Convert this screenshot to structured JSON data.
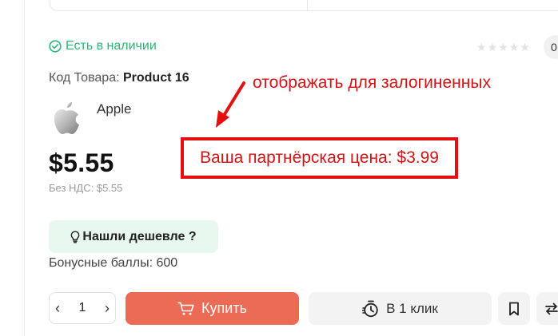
{
  "stock": {
    "label": "Есть в наличии",
    "color": "#2bb673"
  },
  "rating": {
    "stars": 0,
    "max": 5,
    "count_label": "0"
  },
  "sku": {
    "label": "Код Товара:",
    "value": "Product 16"
  },
  "brand": {
    "name": "Apple"
  },
  "price": {
    "main": "$5.55",
    "no_vat": "Без НДС: $5.55"
  },
  "cheaper": {
    "label": "Нашли дешевле ?"
  },
  "bonus": {
    "label": "Бонусные баллы: 600"
  },
  "quantity": {
    "value": "1",
    "decrement": "‹",
    "increment": "›"
  },
  "buy": {
    "label": "Купить",
    "color": "#ec6b54"
  },
  "one_click": {
    "label": "В 1 клик"
  },
  "annotation": {
    "note": "отображать для залогиненных",
    "partner_price": "Ваша партнёрская цена: $3.99",
    "color": "#e31010"
  }
}
